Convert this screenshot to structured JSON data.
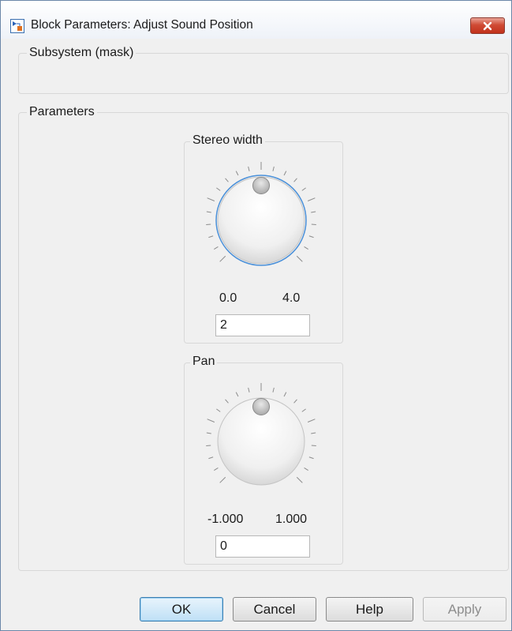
{
  "window": {
    "title": "Block Parameters: Adjust Sound Position",
    "close_icon": "close-icon",
    "app_icon": "simulink-block-icon"
  },
  "subsystem_group": {
    "title": "Subsystem (mask)"
  },
  "parameters_group": {
    "title": "Parameters"
  },
  "knobs": [
    {
      "title": "Stereo width",
      "min_label": "0.0",
      "max_label": "4.0",
      "value": "2",
      "focused": true
    },
    {
      "title": "Pan",
      "min_label": "-1.000",
      "max_label": "1.000",
      "value": "0",
      "focused": false
    }
  ],
  "buttons": {
    "ok": "OK",
    "cancel": "Cancel",
    "help": "Help",
    "apply": "Apply"
  },
  "colors": {
    "close_button": "#c8412d",
    "focus_ring": "#4a90d9",
    "default_button_border": "#3c7fb1"
  }
}
